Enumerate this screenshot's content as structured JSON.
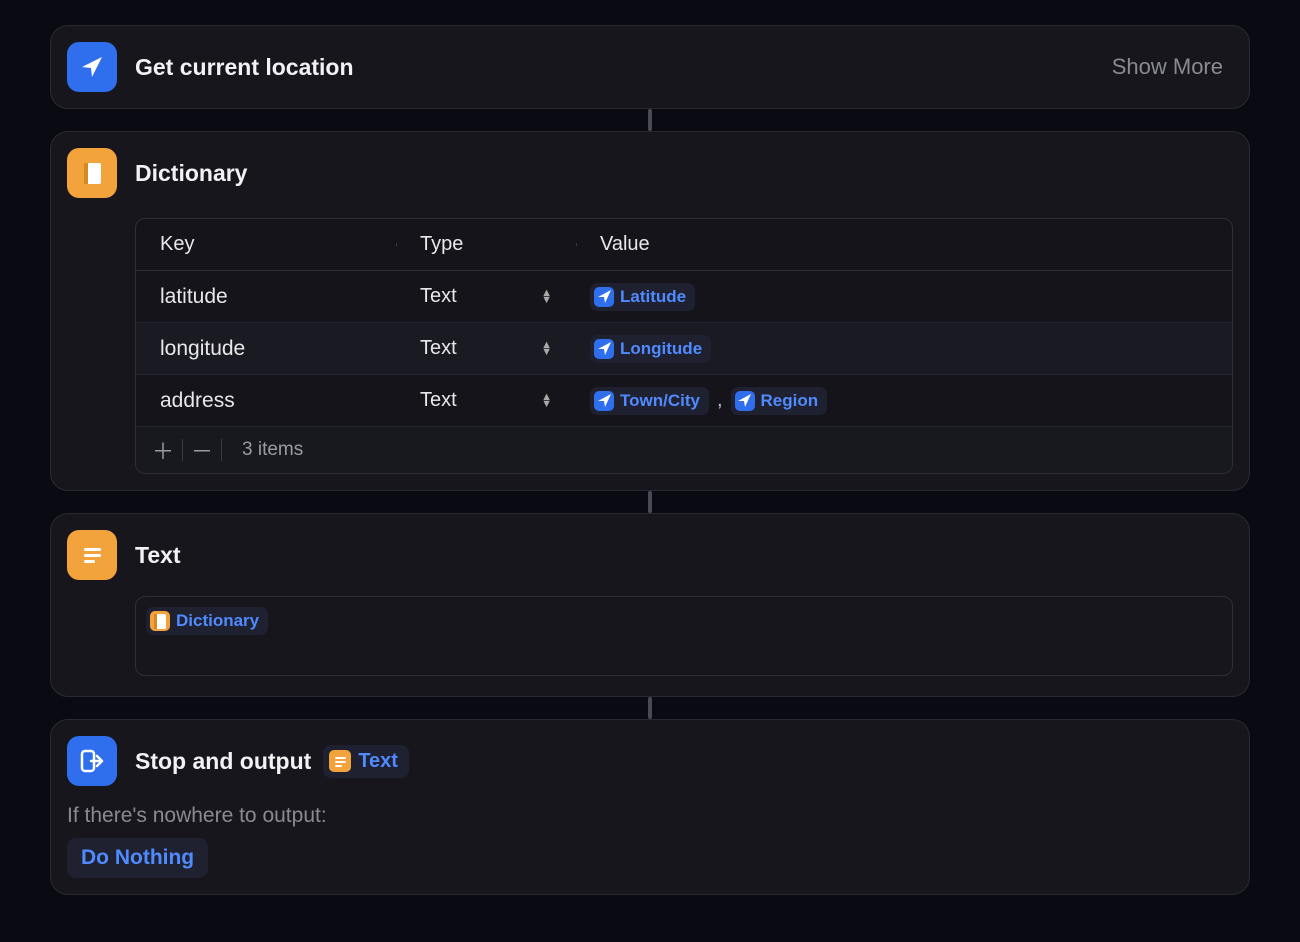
{
  "actions": {
    "location": {
      "title": "Get current location",
      "show_more": "Show More"
    },
    "dictionary": {
      "title": "Dictionary",
      "columns": {
        "key": "Key",
        "type": "Type",
        "value": "Value"
      },
      "rows": [
        {
          "key": "latitude",
          "type": "Text",
          "tokens": [
            {
              "label": "Latitude",
              "icon": "location"
            }
          ]
        },
        {
          "key": "longitude",
          "type": "Text",
          "tokens": [
            {
              "label": "Longitude",
              "icon": "location"
            }
          ]
        },
        {
          "key": "address",
          "type": "Text",
          "tokens": [
            {
              "label": "Town/City",
              "icon": "location"
            },
            {
              "label": "Region",
              "icon": "location"
            }
          ],
          "separator": ","
        }
      ],
      "footer": {
        "count": "3 items"
      }
    },
    "text": {
      "title": "Text",
      "token": {
        "label": "Dictionary",
        "icon": "dictionary"
      }
    },
    "stop": {
      "title": "Stop and output",
      "token": {
        "label": "Text",
        "icon": "text-lines"
      },
      "subtext": "If there's nowhere to output:",
      "option": "Do Nothing"
    }
  }
}
